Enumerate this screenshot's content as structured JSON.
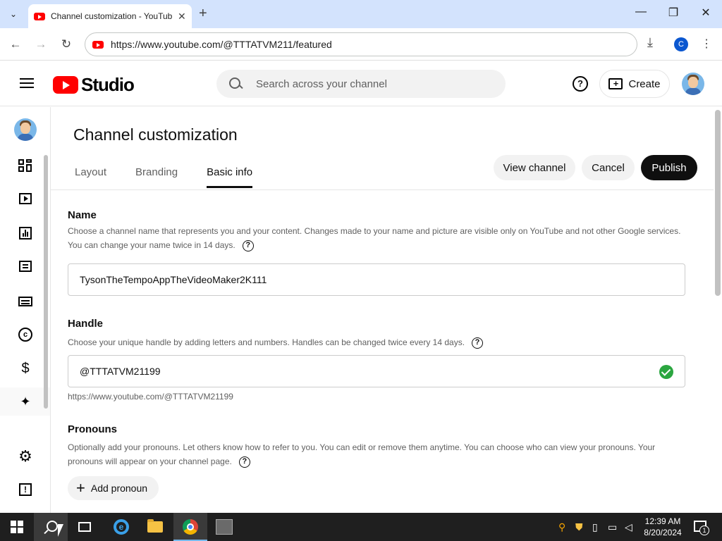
{
  "browser": {
    "tab_title": "Channel customization - YouTube Studio",
    "url": "https://www.youtube.com/@TTTATVM211/featured",
    "profile_initial": "C"
  },
  "studio_header": {
    "logo_text": "Studio",
    "search_placeholder": "Search across your channel",
    "create_label": "Create"
  },
  "sidebar": {
    "icons": [
      "dashboard-icon",
      "content-icon",
      "analytics-icon",
      "comments-icon",
      "subtitles-icon",
      "copyright-icon",
      "earn-icon",
      "customization-icon",
      "settings-icon",
      "feedback-icon"
    ]
  },
  "page": {
    "title": "Channel customization",
    "tabs": [
      {
        "label": "Layout"
      },
      {
        "label": "Branding"
      },
      {
        "label": "Basic info"
      }
    ],
    "view_channel": "View channel",
    "cancel": "Cancel",
    "publish": "Publish"
  },
  "name_section": {
    "title": "Name",
    "description": "Choose a channel name that represents you and your content. Changes made to your name and picture are visible only on YouTube and not other Google services. You can change your name twice in 14 days.",
    "value": "TysonTheTempoAppTheVideoMaker2K111"
  },
  "handle_section": {
    "title": "Handle",
    "description": "Choose your unique handle by adding letters and numbers. Handles can be changed twice every 14 days.",
    "value": "@TTTATVM21199",
    "url_preview": "https://www.youtube.com/@TTTATVM21199"
  },
  "pronouns_section": {
    "title": "Pronouns",
    "description": "Optionally add your pronouns. Let others know how to refer to you. You can edit or remove them anytime. You can choose who can view your pronouns. Your pronouns will appear on your channel page.",
    "add_label": "Add pronoun"
  },
  "taskbar": {
    "time": "12:39 AM",
    "date": "8/20/2024",
    "notification_count": "1"
  },
  "colors": {
    "youtube_red": "#ff0000",
    "verified_green": "#2ba640",
    "publish_bg": "#0f0f0f"
  }
}
